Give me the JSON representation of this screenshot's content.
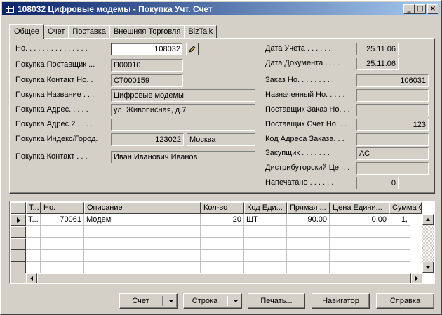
{
  "window": {
    "title": "108032 Цифровые модемы - Покупка Учт. Счет",
    "controls": {
      "minimize": "_",
      "maximize": "□",
      "close": "×"
    }
  },
  "tabs": [
    {
      "label": "Общее",
      "active": true
    },
    {
      "label": "Счет"
    },
    {
      "label": "Поставка"
    },
    {
      "label": "Внешняя Торговля"
    },
    {
      "label": "BizTalk"
    }
  ],
  "general": {
    "left": [
      {
        "label": "Но. . . . . . . . . . . . . . .",
        "value": "108032"
      },
      {
        "label": "Покупка Поставщик ...",
        "value": "П00010"
      },
      {
        "label": "Покупка Контакт Но. .",
        "value": "СТ000159"
      },
      {
        "label": "Покупка Название . . .",
        "value": "Цифровые модемы"
      },
      {
        "label": "Покупка Адрес. . . . .",
        "value": "ул. Живописная, д.7"
      },
      {
        "label": "Покупка Адрес 2 . . . .",
        "value": ""
      },
      {
        "label": "Покупка Индекс/Город.",
        "value": "123022",
        "value2": "Москва"
      },
      {
        "label": "Покупка Контакт . . .",
        "value": "Иван Иванович Иванов"
      }
    ],
    "right": [
      {
        "label": "Дата Учета . . . . . .",
        "value": "25.11.06"
      },
      {
        "label": "Дата Документа . . . .",
        "value": "25.11.06"
      },
      {
        "label": "Заказ Но. . . . . . . . . .",
        "value": "106031"
      },
      {
        "label": "Назначенный Но. . . . .",
        "value": ""
      },
      {
        "label": "Поставщик Заказ Но. . .",
        "value": ""
      },
      {
        "label": "Поставщик Счет Но. . .",
        "value": "123"
      },
      {
        "label": "Код Адреса Заказа. . .",
        "value": ""
      },
      {
        "label": "Закупщик . . . . . . .",
        "value": "АС"
      },
      {
        "label": "Дистрибуторский Це. . .",
        "value": ""
      },
      {
        "label": "Напечатано . . . . . .",
        "value": "0"
      }
    ]
  },
  "lines": {
    "columns": [
      "Т...",
      "Но.",
      "Описание",
      "Кол-во",
      "Код Еди...",
      "Прямая ...",
      "Цена Едини...",
      "Сумма С"
    ],
    "rows": [
      [
        "Т...",
        "70061",
        "Модем",
        "20",
        "ШТ",
        "90.00",
        "0.00",
        "1,"
      ]
    ]
  },
  "buttons": {
    "invoice": "Счет",
    "line": "Строка",
    "print": "Печать...",
    "navigator": "Навигатор",
    "help": "Справка"
  }
}
